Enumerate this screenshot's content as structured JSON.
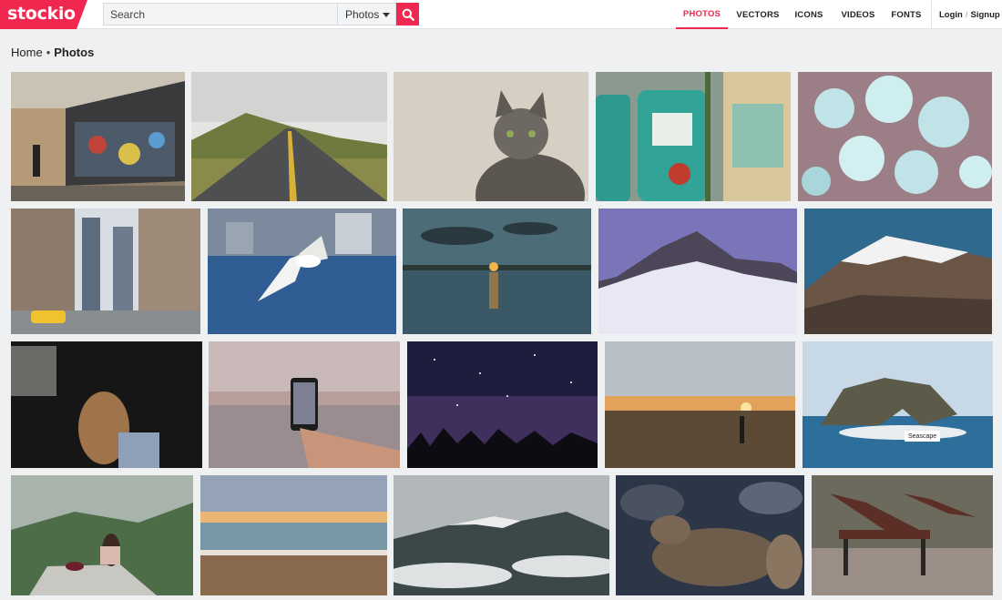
{
  "brand": {
    "name": "stockio",
    "color": "#f0274f"
  },
  "search": {
    "placeholder": "Search",
    "value": "",
    "type_selected": "Photos"
  },
  "nav": {
    "items": [
      "PHOTOS",
      "VECTORS",
      "ICONS",
      "VIDEOS",
      "FONTS"
    ],
    "active": "PHOTOS"
  },
  "auth": {
    "login": "Login",
    "separator": "/",
    "signup": "Signup"
  },
  "breadcrumb": {
    "home": "Home",
    "separator": "•",
    "current": "Photos"
  },
  "photos": [
    {
      "subject": "graffiti-street"
    },
    {
      "subject": "empty-road"
    },
    {
      "subject": "gray-cat"
    },
    {
      "subject": "retro-gas-pumps"
    },
    {
      "subject": "white-blossoms"
    },
    {
      "subject": "city-street-taxi"
    },
    {
      "subject": "seagull-flight"
    },
    {
      "subject": "sunset-lake"
    },
    {
      "subject": "snowy-peak"
    },
    {
      "subject": "mountain-range"
    },
    {
      "subject": "woman-window"
    },
    {
      "subject": "phone-sunset"
    },
    {
      "subject": "starry-night"
    },
    {
      "subject": "field-sunset"
    },
    {
      "subject": "seascape-rock",
      "tag": "Seascape"
    },
    {
      "subject": "girl-cliff"
    },
    {
      "subject": "beach-waves"
    },
    {
      "subject": "cloudy-mountains"
    },
    {
      "subject": "sea-lion"
    },
    {
      "subject": "park-benches"
    }
  ]
}
